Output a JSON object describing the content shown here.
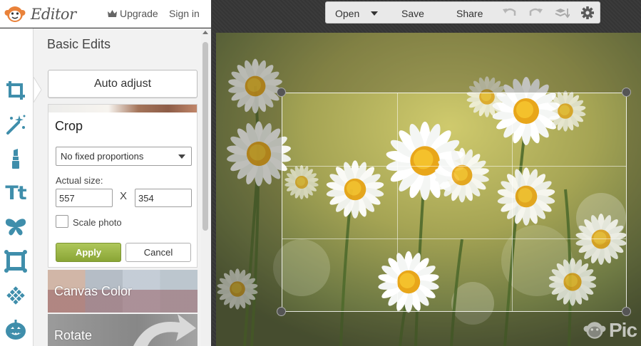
{
  "app": {
    "title": "Editor",
    "upgrade_label": "Upgrade",
    "signin_label": "Sign in"
  },
  "toolbar": {
    "open_label": "Open",
    "save_label": "Save",
    "share_label": "Share"
  },
  "panel": {
    "title": "Basic Edits",
    "auto_adjust_label": "Auto adjust",
    "crop": {
      "title": "Crop",
      "proportion_selected": "No fixed proportions",
      "actual_size_label": "Actual size:",
      "width": "557",
      "height": "354",
      "separator": "X",
      "scale_label": "Scale photo",
      "scale_checked": false,
      "apply_label": "Apply",
      "cancel_label": "Cancel"
    },
    "tiles": [
      {
        "label": "Canvas Color"
      },
      {
        "label": "Rotate"
      }
    ]
  },
  "tools": [
    {
      "name": "crop-icon",
      "active": true
    },
    {
      "name": "magic-wand-icon"
    },
    {
      "name": "lipstick-icon"
    },
    {
      "name": "text-icon",
      "glyph": "Tt"
    },
    {
      "name": "butterfly-icon"
    },
    {
      "name": "frame-icon"
    },
    {
      "name": "texture-icon"
    },
    {
      "name": "pumpkin-icon"
    }
  ],
  "watermark": {
    "text": "Pic"
  },
  "colors": {
    "accent_blue": "#3f8eab",
    "apply_green": "#9bb646",
    "logo_orange": "#e9823a"
  }
}
